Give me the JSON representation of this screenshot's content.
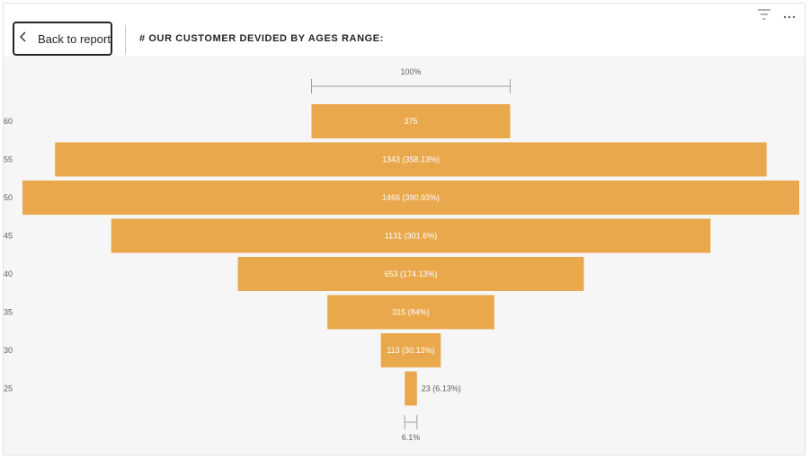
{
  "header": {
    "back_label": "Back to report",
    "title": "# OUR CUSTOMER DEVIDED BY AGES RANGE:",
    "icons": [
      "filter-icon",
      "more-options-icon"
    ]
  },
  "chart_data": {
    "type": "funnel",
    "title": "# OUR CUSTOMER DEVIDED BY AGES RANGE:",
    "categories": [
      "60",
      "55",
      "50",
      "45",
      "40",
      "35",
      "30",
      "25"
    ],
    "values": [
      375,
      1343,
      1466,
      1131,
      653,
      315,
      113,
      23
    ],
    "data_labels": [
      "375",
      "1343 (358.13%)",
      "1466 (390.93%)",
      "1131 (301.6%)",
      "653 (174.13%)",
      "315 (84%)",
      "113 (30.13%)",
      "23 (6.13%)"
    ],
    "top_percent_label": "100%",
    "bottom_percent_label": "6.1%",
    "bar_color": "#e9a84c",
    "grid": false
  }
}
